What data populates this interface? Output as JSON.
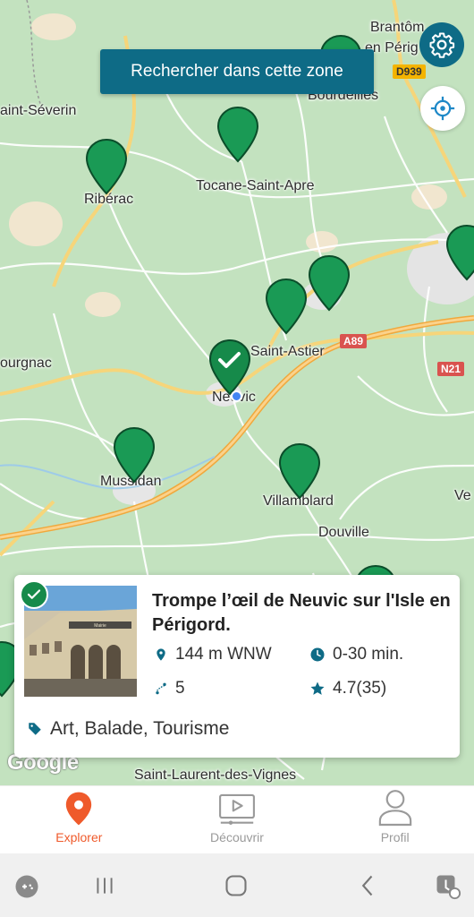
{
  "map": {
    "search_button": "Rechercher dans cette zone",
    "places": [
      {
        "name": "Brantôm",
        "key": "brantome"
      },
      {
        "name": "en Périg",
        "key": "enperig"
      },
      {
        "name": "Bourdeilles",
        "key": "bourdeilles"
      },
      {
        "name": "aint-Séverin",
        "key": "severin"
      },
      {
        "name": "Ribérac",
        "key": "riberac"
      },
      {
        "name": "Tocane-Saint-Apre",
        "key": "tocane"
      },
      {
        "name": "Saint-Astier",
        "key": "astier"
      },
      {
        "name": "ourgnac",
        "key": "ourgnac"
      },
      {
        "name": "Neuvic",
        "key": "neuvic"
      },
      {
        "name": "Mussidan",
        "key": "mussidan"
      },
      {
        "name": "Villamblard",
        "key": "villamblard"
      },
      {
        "name": "Douville",
        "key": "douville"
      },
      {
        "name": "Ve",
        "key": "ve"
      },
      {
        "name": "Saint-Laurent-des-Vignes",
        "key": "laurent"
      }
    ],
    "roads": {
      "d939": "D939",
      "a89": "A89",
      "n21": "N21"
    },
    "attribution": "Google"
  },
  "card": {
    "title": "Trompe l’œil de Neuvic sur l'Isle en Périgord.",
    "distance": "144 m WNW",
    "duration": "0-30 min.",
    "steps": "5",
    "rating": "4.7(35)",
    "tags": "Art, Balade, Tourisme",
    "photo_sign": "Mairie"
  },
  "nav": {
    "explorer": "Explorer",
    "decouvrir": "Découvrir",
    "profil": "Profil"
  },
  "colors": {
    "accent": "#0e6b86",
    "pin": "#1a9a55",
    "active_tab": "#ef5a2b"
  }
}
